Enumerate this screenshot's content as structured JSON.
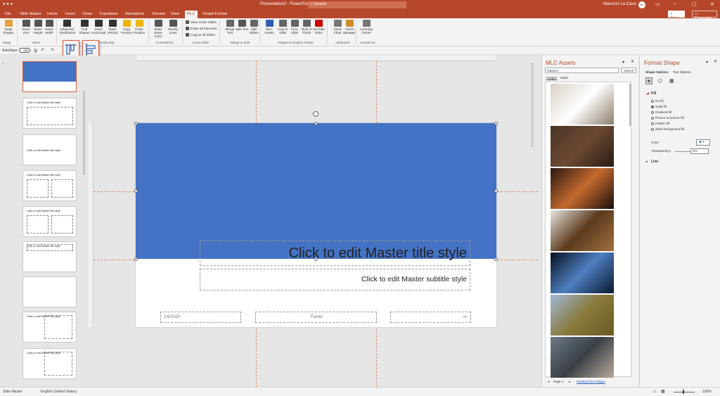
{
  "titlebar": {
    "doc_title": "Presentation2 - PowerPoint",
    "search_placeholder": "Search",
    "user": "Mauricio La Cava",
    "avatar_initials": "MC"
  },
  "tabs": [
    "File",
    "Slide Master",
    "Home",
    "Insert",
    "Draw",
    "Transitions",
    "Animations",
    "Review",
    "View",
    "MLC",
    "Shape Format"
  ],
  "tab_active": "MLC",
  "share_label": "Share",
  "comments_label": "Comments",
  "ribbon": {
    "buttons": [
      {
        "label": "Swap Shapes"
      },
      {
        "label": "Same Size"
      },
      {
        "label": "Same Height"
      },
      {
        "label": "Same Width"
      },
      {
        "label": "Advanced Distribution"
      },
      {
        "label": "Grid Shapes"
      },
      {
        "label": "Stack Horizontal"
      },
      {
        "label": "Stack Vertical"
      },
      {
        "label": "Copy Position"
      },
      {
        "label": "Paste Position"
      },
      {
        "label": "Make Same Color"
      },
      {
        "label": "Rectify Lines"
      },
      {
        "label": "Merge Text"
      },
      {
        "label": "Split Text"
      },
      {
        "label": "Split Tables"
      },
      {
        "label": "MLC Assets"
      },
      {
        "label": "Crop to Slide"
      },
      {
        "label": "Fit to Slide"
      },
      {
        "label": "Rule of Thirds"
      },
      {
        "label": "YouTube Video"
      },
      {
        "label": "Gantt Chart"
      },
      {
        "label": "Colors Manager"
      },
      {
        "label": "Learning Centre"
      }
    ],
    "cross_slide": [
      "Save Active Slides",
      "Erase all Elements",
      "Copy to all Slides"
    ],
    "groups": [
      "Swap",
      "Sizes",
      "Positioning",
      "Consistency",
      "Cross Slide",
      "Merge & Split",
      "Images & Graphic Assets",
      "Advanced",
      "Contact us"
    ]
  },
  "qat": {
    "autosave": "AutoSave",
    "autosave_state": "Off"
  },
  "thumbnails": [
    {
      "num": "1",
      "title": ""
    },
    {
      "num": "",
      "title": "Click to edit Master title style"
    },
    {
      "num": "",
      "title": "Click to edit Master title style"
    },
    {
      "num": "",
      "title": "Click to edit Master title style"
    },
    {
      "num": "",
      "title": "Click to edit Master title style"
    },
    {
      "num": "",
      "title": "Click to edit Master title style"
    },
    {
      "num": "",
      "title": ""
    },
    {
      "num": "",
      "title": "Click to edit Master title style"
    },
    {
      "num": "",
      "title": "Click to edit Master title style"
    }
  ],
  "slide": {
    "title": "Click to edit Master title style",
    "subtitle": "Click to edit Master subtitle style",
    "date": "1/6/2020",
    "footer": "Footer",
    "page_num": "‹#›"
  },
  "mlc": {
    "title": "MLC Assets",
    "search_value": "tobacco",
    "search_button": "Search",
    "tabs": [
      "Images",
      "Maps"
    ],
    "page_label": "Page 1",
    "credit": "Pixabay free images",
    "images": [
      {
        "colors": [
          "#d9d0c4",
          "#ffffff",
          "#8e7e6b"
        ]
      },
      {
        "colors": [
          "#4a3324",
          "#6b4a34",
          "#2a1b12"
        ]
      },
      {
        "colors": [
          "#2a1712",
          "#c46a2e",
          "#1a0e0b"
        ]
      },
      {
        "colors": [
          "#e8e4df",
          "#5c3a1d",
          "#a07040"
        ]
      },
      {
        "colors": [
          "#07101e",
          "#4d7fc0",
          "#0a1830"
        ]
      },
      {
        "colors": [
          "#9fb8d8",
          "#8a7a3c",
          "#6a5b24"
        ]
      },
      {
        "colors": [
          "#6c7a86",
          "#3a3f46",
          "#b9aa9b"
        ]
      }
    ]
  },
  "format": {
    "title": "Format Shape",
    "tabs": [
      "Shape Options",
      "Text Options"
    ],
    "fill_label": "Fill",
    "fill_options": [
      "No fill",
      "Solid fill",
      "Gradient fill",
      "Picture or texture fill",
      "Pattern fill",
      "Slide background fill"
    ],
    "selected_fill": "Solid fill",
    "color_label": "Color",
    "transparency_label": "Transparency",
    "transparency_value": "0%",
    "line_label": "Line",
    "accent": "#4472c4"
  },
  "status": {
    "view": "Slide Master",
    "language": "English (United States)",
    "zoom": "100%"
  }
}
